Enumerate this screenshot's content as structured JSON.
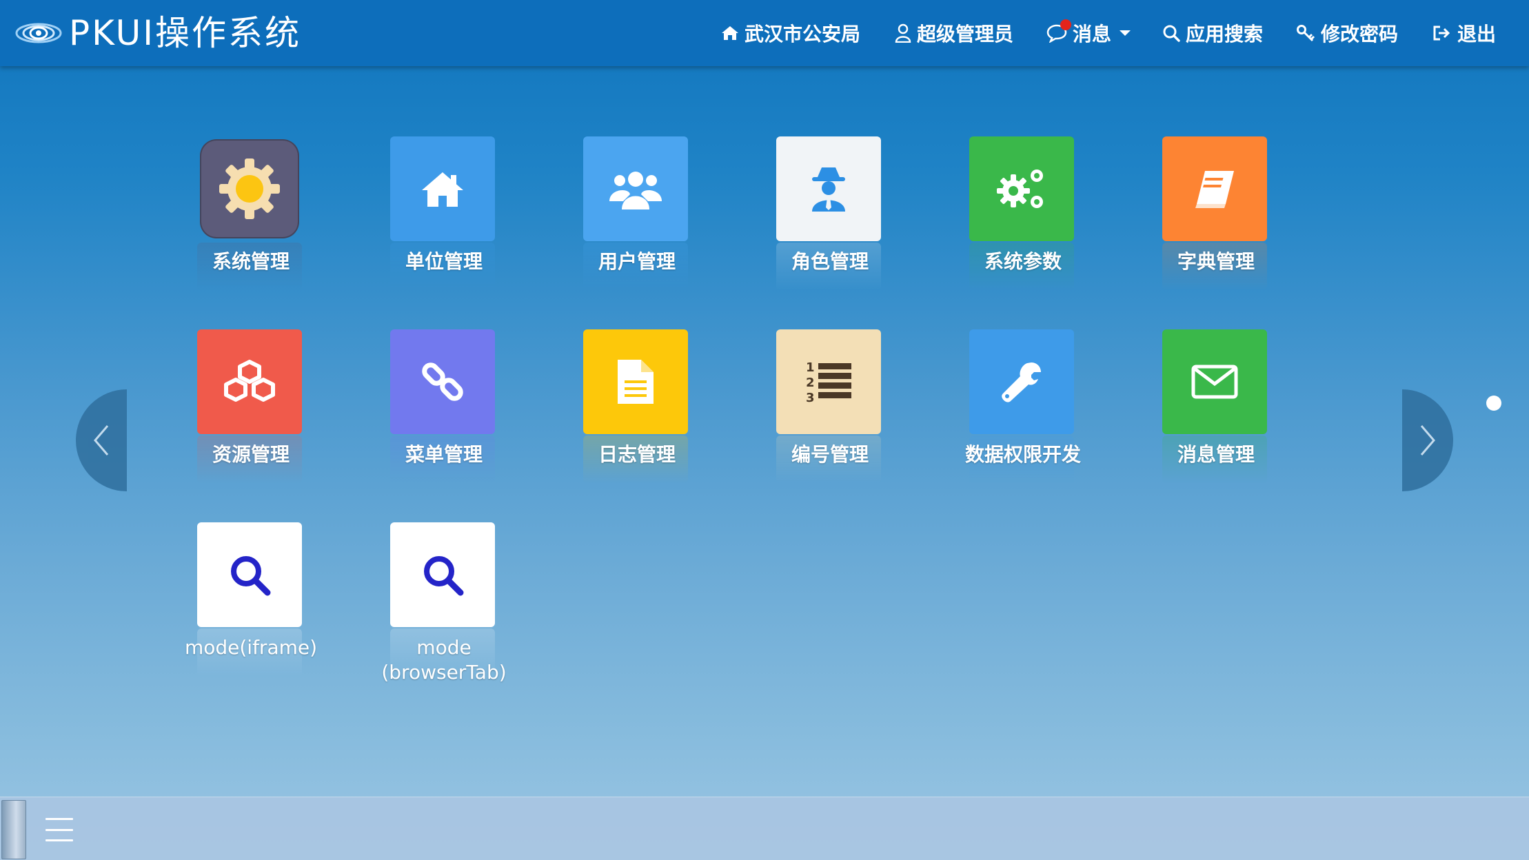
{
  "header": {
    "title": "PKUI操作系统",
    "nav": {
      "police": "武汉市公安局",
      "admin": "超级管理员",
      "messages": "消息",
      "app_search": "应用搜索",
      "change_password": "修改密码",
      "logout": "退出"
    }
  },
  "apps": [
    {
      "label": "系统管理",
      "icon": "gear-icon"
    },
    {
      "label": "单位管理",
      "icon": "home-icon"
    },
    {
      "label": "用户管理",
      "icon": "users-icon"
    },
    {
      "label": "角色管理",
      "icon": "spy-icon"
    },
    {
      "label": "系统参数",
      "icon": "cogs-icon"
    },
    {
      "label": "字典管理",
      "icon": "book-icon"
    },
    {
      "label": "资源管理",
      "icon": "cubes-icon"
    },
    {
      "label": "菜单管理",
      "icon": "link-icon"
    },
    {
      "label": "日志管理",
      "icon": "document-icon"
    },
    {
      "label": "编号管理",
      "icon": "numbered-list-icon"
    },
    {
      "label": "数据权限开发",
      "icon": "wrench-icon"
    },
    {
      "label": "消息管理",
      "icon": "envelope-icon"
    },
    {
      "label": "mode(iframe)",
      "icon": "search-icon"
    },
    {
      "label": "mode\n(browserTab)",
      "icon": "search-icon"
    }
  ],
  "colors": {
    "header": "#0d6ebb",
    "tile_system": "#5c5b7a",
    "tile_blue": "#3e9be9",
    "tile_light": "#f1f4f7",
    "tile_green": "#3ab84a",
    "tile_orange": "#fd8433",
    "tile_red": "#f05a4b",
    "tile_purple": "#7279ee",
    "tile_yellow": "#fdc80a",
    "tile_beige": "#f3dfb6",
    "tile_white": "#ffffff"
  }
}
